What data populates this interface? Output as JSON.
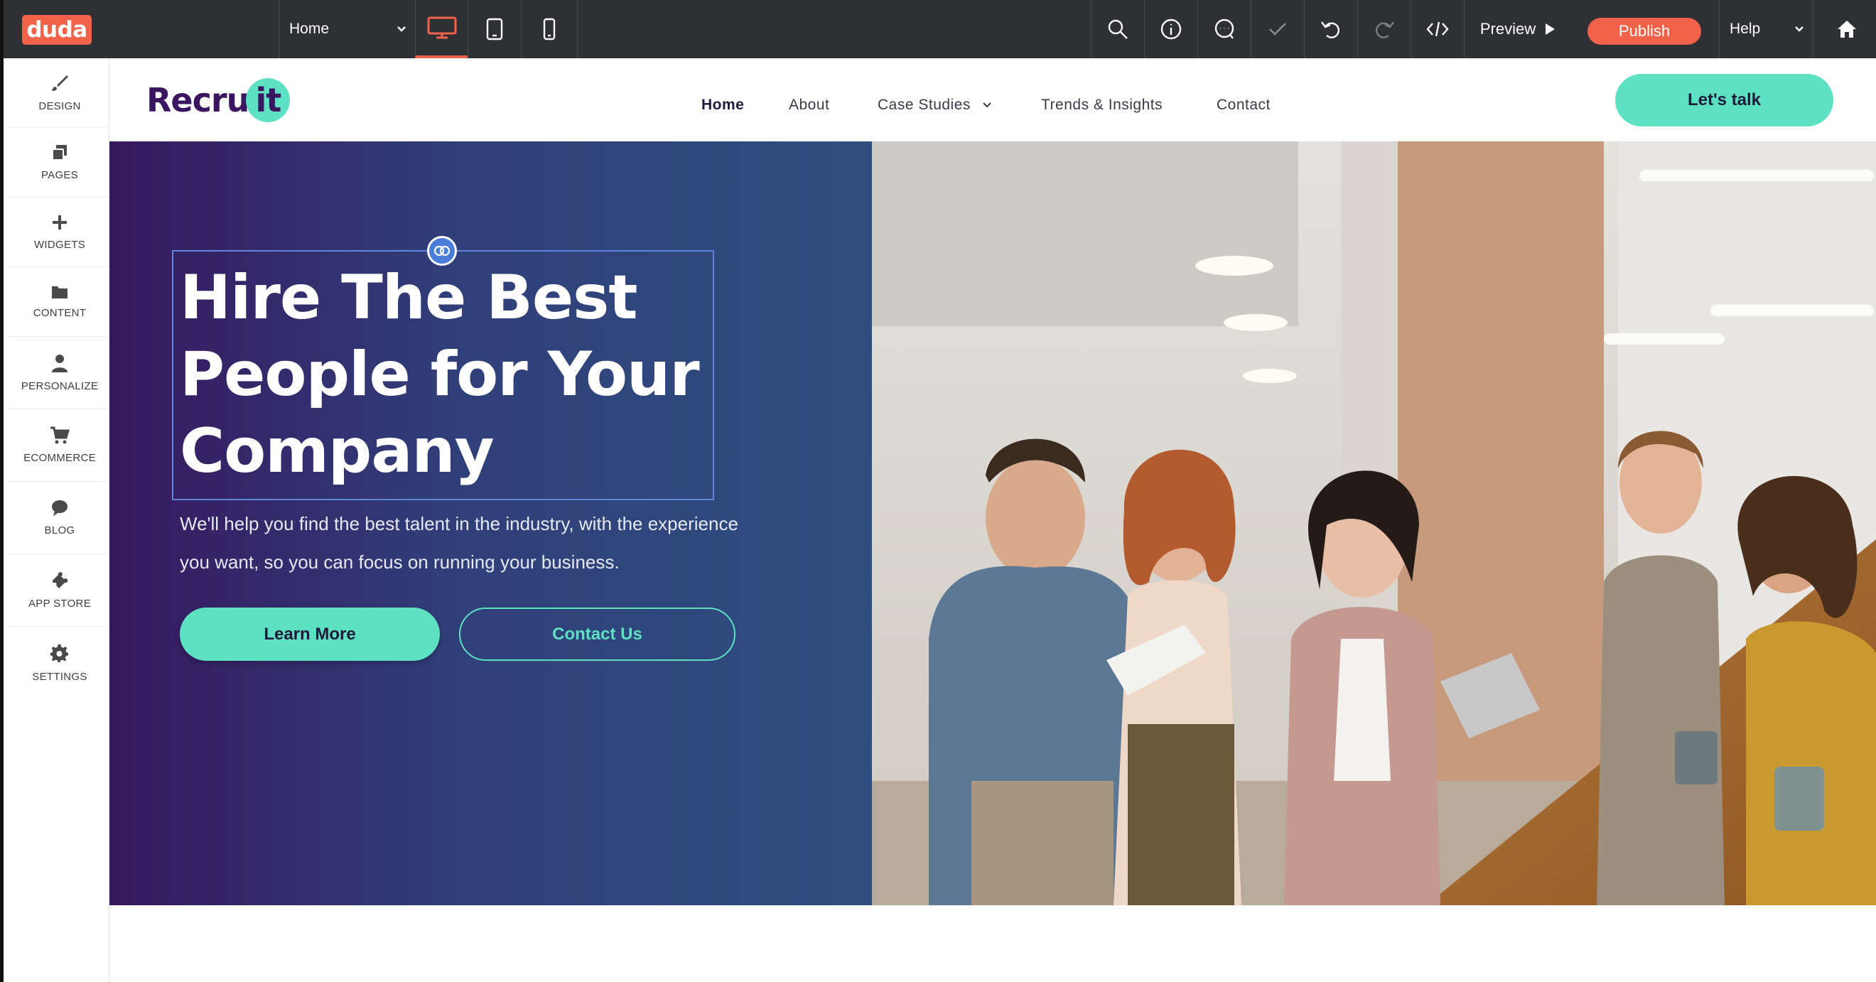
{
  "editor": {
    "logo": "duda",
    "page_selector": "Home",
    "toolbar_icons": [
      "desktop-icon",
      "tablet-icon",
      "mobile-icon",
      "search-icon",
      "info-icon",
      "comment-icon",
      "check-icon",
      "undo-icon",
      "redo-icon",
      "code-icon"
    ],
    "preview_label": "Preview",
    "publish_label": "Publish",
    "help_label": "Help",
    "accent_color": "#f0634a"
  },
  "sidebar": {
    "items": [
      {
        "label": "DESIGN",
        "icon": "brush-icon"
      },
      {
        "label": "PAGES",
        "icon": "pages-icon"
      },
      {
        "label": "WIDGETS",
        "icon": "plus-icon"
      },
      {
        "label": "CONTENT",
        "icon": "folder-icon"
      },
      {
        "label": "PERSONALIZE",
        "icon": "person-icon"
      },
      {
        "label": "ECOMMERCE",
        "icon": "cart-icon"
      },
      {
        "label": "BLOG",
        "icon": "speech-bubble-icon"
      },
      {
        "label": "APP STORE",
        "icon": "puzzle-icon"
      },
      {
        "label": "SETTINGS",
        "icon": "gear-icon"
      }
    ]
  },
  "site": {
    "brand_part1": "Recru",
    "brand_part2": "it",
    "nav": [
      "Home",
      "About",
      "Case Studies",
      "Trends & Insights",
      "Contact"
    ],
    "cta": "Let's talk",
    "hero": {
      "title_line1": "Hire The Best",
      "title_line2": "People for Your",
      "title_line3": "Company",
      "subtitle": " We'll help you find the best talent in the industry, with the experience you want, so you can focus on running your business.",
      "primary_button": "Learn More",
      "secondary_button": "Contact Us"
    },
    "brand_color": "#3a1560",
    "accent_color": "#5de1c2"
  }
}
